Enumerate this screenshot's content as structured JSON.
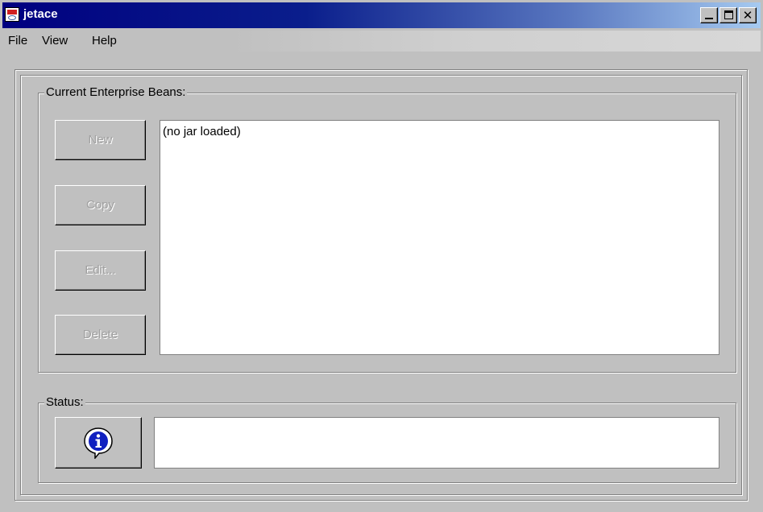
{
  "window": {
    "title": "jetace"
  },
  "menubar": {
    "items": [
      "File",
      "View",
      "Help"
    ]
  },
  "beans_group": {
    "label": "Current Enterprise Beans:",
    "buttons": {
      "new": "New",
      "copy": "Copy",
      "edit": "Edit...",
      "delete": "Delete"
    },
    "list_items": [
      "(no jar loaded)"
    ]
  },
  "status_group": {
    "label": "Status:",
    "info_icon": "info-speech-bubble-icon",
    "status_text": ""
  },
  "colors": {
    "titlebar_start": "#000080",
    "titlebar_end": "#a6caf0",
    "face": "#c0c0c0",
    "disabled_text": "#a0a0a0",
    "info_blue": "#1020c0"
  }
}
